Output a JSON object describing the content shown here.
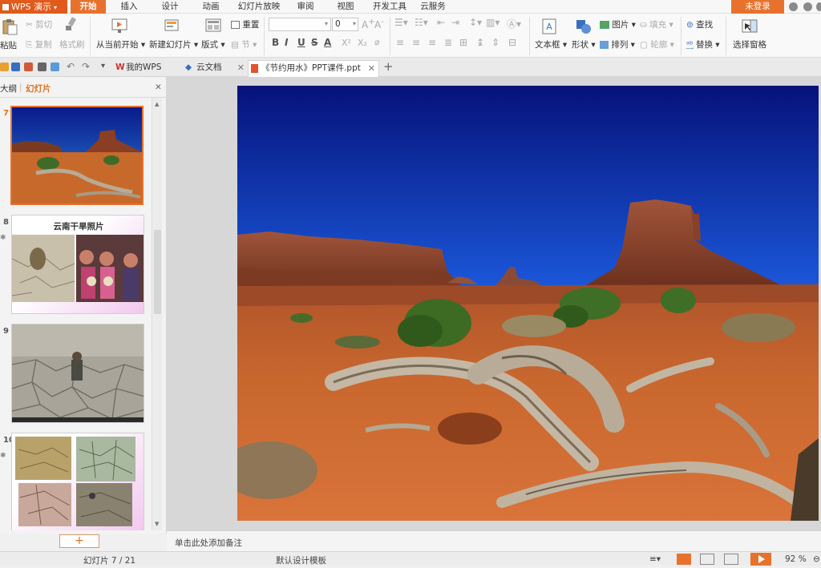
{
  "app": {
    "title": "WPS 演示"
  },
  "menu": {
    "tabs": [
      "开始",
      "插入",
      "设计",
      "动画",
      "幻灯片放映",
      "审阅",
      "视图",
      "开发工具",
      "云服务"
    ],
    "login": "未登录"
  },
  "ribbon": {
    "paste": "粘贴",
    "cut": "剪切",
    "copy": "复制",
    "format_painter": "格式刷",
    "from_current": "从当前开始",
    "new_slide": "新建幻灯片",
    "layout": "版式",
    "reset": "重置",
    "section": "节",
    "font_size": "0",
    "text_box": "文本框",
    "shape": "形状",
    "picture": "图片",
    "fill": "填充",
    "arrange": "排列",
    "outline": "轮廓",
    "find": "查找",
    "replace": "替换",
    "selection_pane": "选择窗格",
    "format_letters": [
      "B",
      "I",
      "U",
      "S",
      "A"
    ]
  },
  "tabs": {
    "my_wps": "我的WPS",
    "cloud_docs": "云文档",
    "document": "《节约用水》PPT课件.ppt"
  },
  "panel": {
    "outline_tab": "大纲",
    "slides_tab": "幻灯片",
    "slides": [
      {
        "num": "7",
        "selected": true
      },
      {
        "num": "8",
        "title": "云南干旱照片"
      },
      {
        "num": "9"
      },
      {
        "num": "10"
      }
    ]
  },
  "notes": {
    "placeholder": "单击此处添加备注"
  },
  "status": {
    "slide_counter": "幻灯片 7 / 21",
    "template": "默认设计模板",
    "zoom": "92 %"
  }
}
